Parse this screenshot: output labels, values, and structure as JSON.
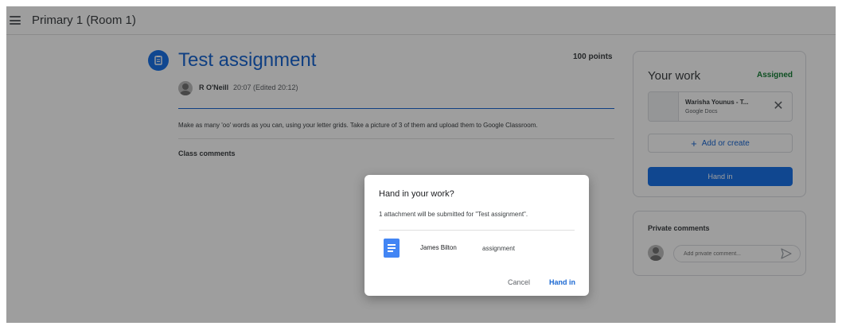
{
  "topbar": {
    "class_title": "Primary 1 (Room 1)"
  },
  "assignment": {
    "title": "Test assignment",
    "points": "100 points",
    "author": "R O'Neill",
    "time": "20:07 (Edited 20:12)",
    "instructions": "Make as many 'oo' words as you can, using your letter grids. Take a picture of 3 of them and upload them to Google Classroom.",
    "class_comments_label": "Class comments"
  },
  "work": {
    "title": "Your work",
    "status": "Assigned",
    "attachment_name": "Warisha Younus - T...",
    "attachment_type": "Google Docs",
    "add_create_label": "Add or create",
    "hand_in_label": "Hand in"
  },
  "private": {
    "title": "Private comments",
    "placeholder": "Add private comment..."
  },
  "dialog": {
    "title": "Hand in your work?",
    "subtitle": "1 attachment will be submitted for \"Test assignment\".",
    "file_name": "James Bilton",
    "file_type": "assignment",
    "cancel_label": "Cancel",
    "hand_in_label": "Hand in"
  },
  "colors": {
    "accent": "#1a73e8",
    "status_green": "#188038",
    "overlay": "rgba(0,0,0,0.38)"
  },
  "icons": [
    "menu-icon",
    "assignment-icon",
    "close-icon",
    "plus-icon",
    "send-icon",
    "docs-icon"
  ]
}
